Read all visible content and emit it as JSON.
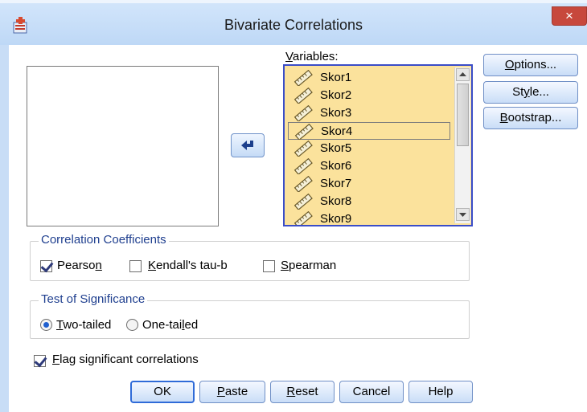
{
  "window": {
    "title": "Bivariate Correlations",
    "close_glyph": "×"
  },
  "variables": {
    "label": "Variables:",
    "items": [
      "Skor1",
      "Skor2",
      "Skor3",
      "Skor4",
      "Skor5",
      "Skor6",
      "Skor7",
      "Skor8",
      "Skor9"
    ],
    "selected_item": "Skor4"
  },
  "side_buttons": {
    "options": "Options...",
    "style": "Style...",
    "bootstrap": "Bootstrap..."
  },
  "correlation_coefficients": {
    "legend": "Correlation Coefficients",
    "pearson": {
      "label": "Pearson",
      "checked": true
    },
    "kendall": {
      "label": "Kendall's tau-b",
      "checked": false
    },
    "spearman": {
      "label": "Spearman",
      "checked": false
    }
  },
  "test_of_significance": {
    "legend": "Test of Significance",
    "two_tailed": {
      "label": "Two-tailed",
      "selected": true
    },
    "one_tailed": {
      "label": "One-tailed",
      "selected": false
    }
  },
  "flag": {
    "label": "Flag significant correlations",
    "checked": true
  },
  "buttons": {
    "ok": "OK",
    "paste": "Paste",
    "reset": "Reset",
    "cancel": "Cancel",
    "help": "Help"
  },
  "icons": {
    "app": "spss-dialog-icon",
    "move": "arrow-left-icon",
    "variable": "ruler-scale-icon"
  },
  "colors": {
    "variable_list_bg": "#fbe29c",
    "variable_list_border": "#3a4dc8",
    "title_bar": "#c8ddf6",
    "close_button": "#c7483c",
    "group_legend": "#1f3f8f"
  }
}
